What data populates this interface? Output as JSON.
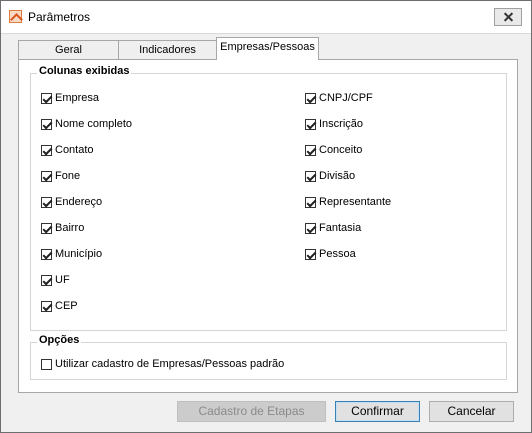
{
  "window": {
    "title": "Parâmetros"
  },
  "tabs": [
    {
      "label": "Geral"
    },
    {
      "label": "Indicadores"
    },
    {
      "label": "Empresas/Pessoas"
    }
  ],
  "colunas": {
    "title": "Colunas exibidas",
    "left": [
      {
        "label": "Empresa",
        "checked": true
      },
      {
        "label": "Nome completo",
        "checked": true
      },
      {
        "label": "Contato",
        "checked": true
      },
      {
        "label": "Fone",
        "checked": true
      },
      {
        "label": "Endereço",
        "checked": true
      },
      {
        "label": "Bairro",
        "checked": true
      },
      {
        "label": "Município",
        "checked": true
      },
      {
        "label": "UF",
        "checked": true
      },
      {
        "label": "CEP",
        "checked": true
      }
    ],
    "right": [
      {
        "label": "CNPJ/CPF",
        "checked": true
      },
      {
        "label": "Inscrição",
        "checked": true
      },
      {
        "label": "Conceito",
        "checked": true
      },
      {
        "label": "Divisão",
        "checked": true
      },
      {
        "label": "Representante",
        "checked": true
      },
      {
        "label": "Fantasia",
        "checked": true
      },
      {
        "label": "Pessoa",
        "checked": true
      }
    ]
  },
  "opcoes": {
    "title": "Opções",
    "padrao_label": "Utilizar cadastro de Empresas/Pessoas padrão",
    "padrao_checked": false
  },
  "buttons": {
    "cadastro_etapas": "Cadastro de Etapas",
    "confirmar": "Confirmar",
    "cancelar": "Cancelar"
  }
}
